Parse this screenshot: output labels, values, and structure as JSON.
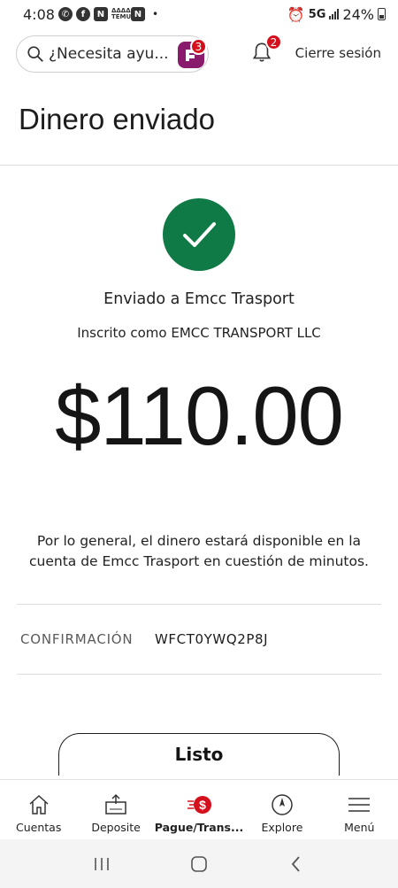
{
  "status_bar": {
    "time": "4:08",
    "network": "5G",
    "battery": "24%",
    "dot": "•",
    "temu_label": "ΔΔΔΔ TEMU"
  },
  "header": {
    "search_placeholder": "¿Necesita ayu...",
    "assistant_badge": "3",
    "notifications_badge": "2",
    "signout_label": "Cierre sesión"
  },
  "page": {
    "title": "Dinero enviado"
  },
  "confirmation": {
    "sent_to": "Enviado a Emcc Trasport",
    "enrolled_as": "Inscrito como EMCC TRANSPORT LLC",
    "amount": "$110.00",
    "notice": "Por lo general, el dinero estará disponible en la cuenta de Emcc Trasport en cuestión de minutos.",
    "confirmation_label": "CONFIRMACIÓN",
    "confirmation_code": "WFCT0YWQ2P8J",
    "done_label": "Listo"
  },
  "bottom_nav": {
    "items": [
      {
        "label": "Cuentas",
        "icon": "house-icon"
      },
      {
        "label": "Deposite",
        "icon": "deposit-icon"
      },
      {
        "label": "Pague/Trans...",
        "icon": "pay-transfer-icon"
      },
      {
        "label": "Explore",
        "icon": "compass-icon"
      },
      {
        "label": "Menú",
        "icon": "hamburger-menu-icon"
      }
    ]
  },
  "colors": {
    "success_green": "#0f7a45",
    "badge_red": "#d4101d",
    "assistant_purple": "#8a1a6c"
  }
}
